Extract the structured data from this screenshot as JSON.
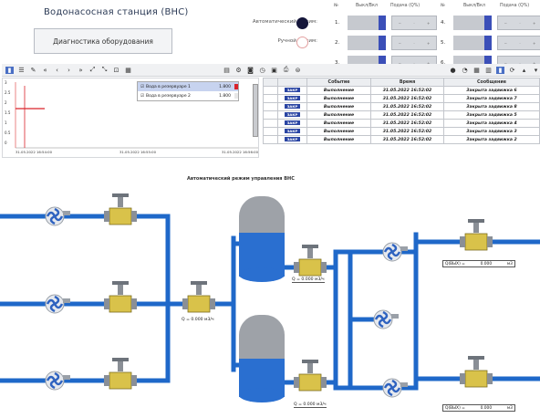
{
  "header": {
    "title": "Водонасосная станция (ВНС)",
    "diagnostics_button": "Диагностика оборудования",
    "auto_mode_label": "Автоматический режим:",
    "manual_mode_label": "Ручной режим:"
  },
  "pump_table": {
    "col_n": "№",
    "col_onoff": "Выкл/Вкл",
    "col_supply": "Подача (Q%)",
    "rows_left": [
      "1.",
      "2.",
      "3."
    ],
    "rows_right": [
      "4.",
      "5.",
      "6."
    ]
  },
  "trend": {
    "y_ticks": [
      "3",
      "2.5",
      "2",
      "1.5",
      "1",
      "0.5",
      "0"
    ],
    "x_ticks": [
      "31.05.2022 16:54:00",
      "31.05.2022 16:55:00",
      "31.05.2022 16:56:00"
    ],
    "legend": [
      {
        "name": "Вода в резервуаре 1",
        "value": "1.800",
        "color": "#d9232b"
      },
      {
        "name": "Вода в резервуаре 2",
        "value": "1.800",
        "color": "#e7e7e7"
      }
    ]
  },
  "events": {
    "headers": [
      "",
      "",
      "Событие",
      "Время",
      "Сообщение"
    ],
    "rows": [
      {
        "badge": "ЗАКР",
        "event": "Выполнение",
        "time": "31.05.2022 16:52:02",
        "message": "Закрыта задвижка 6"
      },
      {
        "badge": "ЗАКР",
        "event": "Выполнение",
        "time": "31.05.2022 16:52:02",
        "message": "Закрыта задвижка 7"
      },
      {
        "badge": "ЗАКР",
        "event": "Выполнение",
        "time": "31.05.2022 16:52:02",
        "message": "Закрыта задвижка 8"
      },
      {
        "badge": "ЗАКР",
        "event": "Выполнение",
        "time": "31.05.2022 16:52:02",
        "message": "Закрыта задвижка 5"
      },
      {
        "badge": "ЗАКР",
        "event": "Выполнение",
        "time": "31.05.2022 16:52:02",
        "message": "Закрыта задвижка 4"
      },
      {
        "badge": "ЗАКР",
        "event": "Выполнение",
        "time": "31.05.2022 16:52:02",
        "message": "Закрыта задвижка 3"
      },
      {
        "badge": "ЗАКР",
        "event": "Выполнение",
        "time": "31.05.2022 16:52:02",
        "message": "Закрыта задвижка 2"
      }
    ]
  },
  "scheme": {
    "title": "Автоматический режим управления ВНС",
    "flow_left": "Q = 0.000 м3/ч",
    "flow_tank1": "Q = 0.000 м3/ч",
    "flow_tank2": "Q = 0.000 м3/ч",
    "out1_label": "Q(ВЫХ) =",
    "out1_value": "0.000",
    "out1_unit": "м3",
    "out2_label": "Q(ВЫХ) =",
    "out2_value": "0.000",
    "out2_unit": "м3"
  },
  "colors": {
    "pipe": "#1f68c9",
    "valve_body": "#d9c24a",
    "tank_water": "#2a6fd0",
    "pump_blue": "#2f63c0"
  }
}
